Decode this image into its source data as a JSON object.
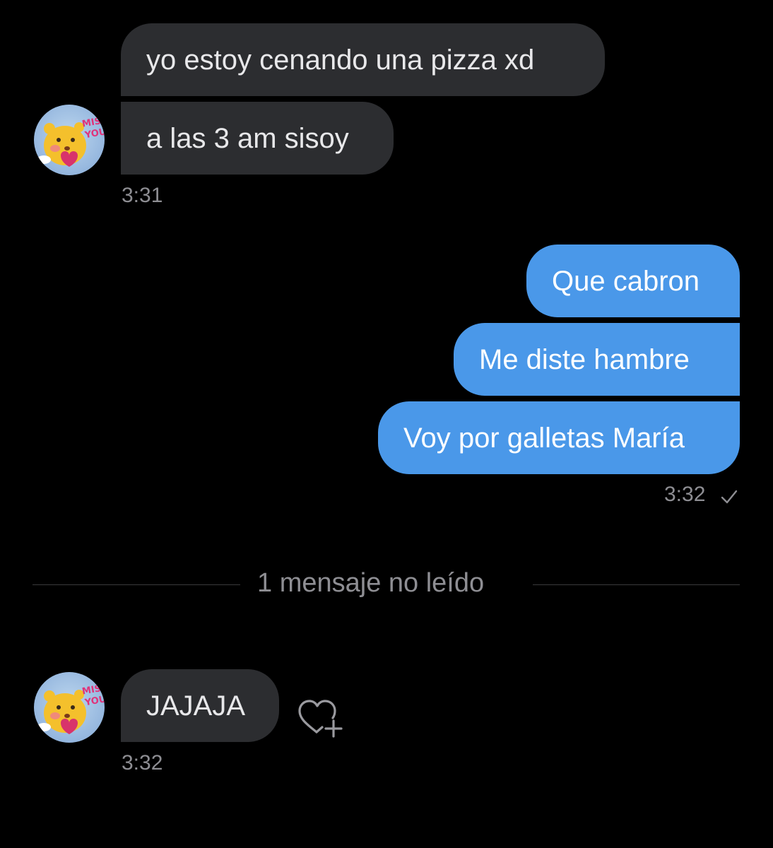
{
  "conversation": {
    "group1": {
      "messages": [
        {
          "text": "yo estoy cenando una pizza xd"
        },
        {
          "text": "a las 3 am sisoy"
        }
      ],
      "time": "3:31"
    },
    "group2": {
      "messages": [
        {
          "text": "Que cabron"
        },
        {
          "text": "Me diste hambre"
        },
        {
          "text": "Voy por galletas María"
        }
      ],
      "time": "3:32",
      "status_icon": "checkmark-icon"
    },
    "unread_divider": {
      "label": "1 mensaje no leído"
    },
    "group3": {
      "messages": [
        {
          "text": "JAJAJA"
        }
      ],
      "time": "3:32",
      "reaction_icon": "heart-plus-icon"
    }
  },
  "avatar": {
    "sticker_text_line1": "MISS",
    "sticker_text_line2": "YOU",
    "icon": "bear-sticker-avatar"
  },
  "colors": {
    "background": "#000000",
    "incoming_bubble": "#2c2d30",
    "outgoing_bubble": "#4a98e9",
    "timestamp": "#8e8e93"
  }
}
